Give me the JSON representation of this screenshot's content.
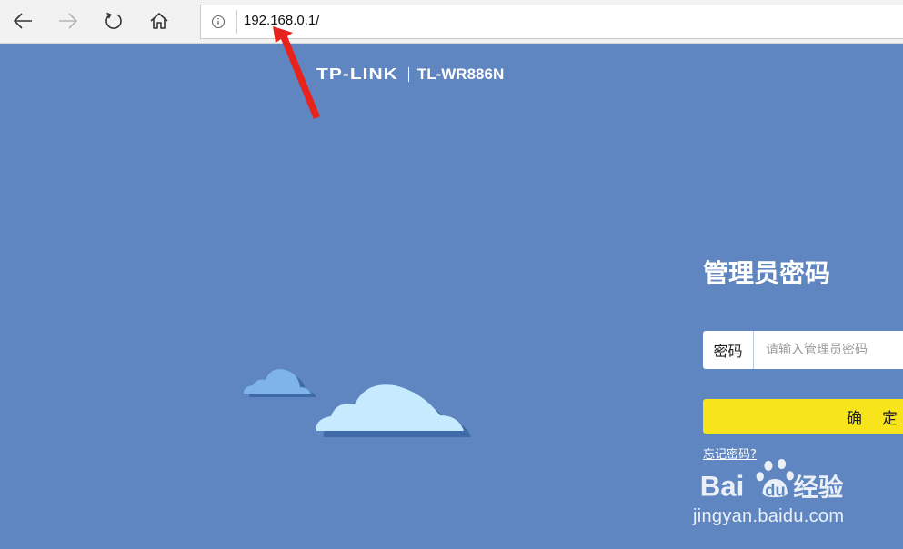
{
  "browser": {
    "back_icon": "arrow-left-icon",
    "forward_icon": "arrow-right-icon",
    "refresh_icon": "refresh-icon",
    "home_icon": "home-icon",
    "info_icon": "info-icon",
    "url": "192.168.0.1/"
  },
  "page": {
    "background_color": "#5f86c0",
    "brand": {
      "logo": "TP-LINK",
      "model": "TL-WR886N"
    },
    "login": {
      "title": "管理员密码",
      "password_label": "密码",
      "password_placeholder": "请输入管理员密码",
      "password_value": "",
      "confirm_label": "确定",
      "confirm_color": "#f8e41a",
      "forgot_link": "忘记密码?"
    }
  },
  "watermark": {
    "logo_text": "Baidu经验",
    "url": "jingyan.baidu.com"
  },
  "annotation": {
    "arrow_color": "#e8231d"
  }
}
